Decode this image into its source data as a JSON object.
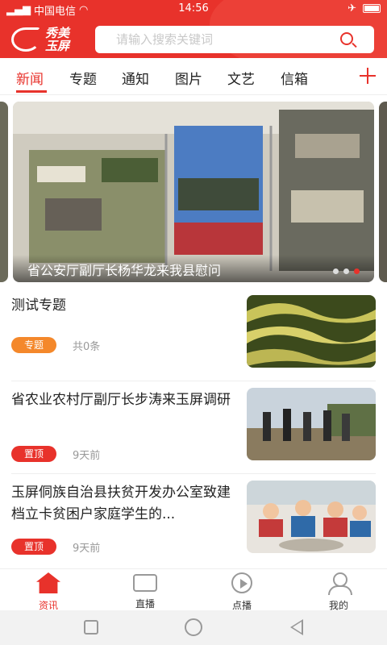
{
  "status_bar": {
    "carrier": "中国电信",
    "time": "14:56"
  },
  "header": {
    "logo_text_line1": "秀美",
    "logo_text_line2": "玉屏",
    "search_placeholder": "请输入搜索关键词"
  },
  "tabs": [
    {
      "label": "新闻",
      "active": true
    },
    {
      "label": "专题",
      "active": false
    },
    {
      "label": "通知",
      "active": false
    },
    {
      "label": "图片",
      "active": false
    },
    {
      "label": "文艺",
      "active": false
    },
    {
      "label": "信箱",
      "active": false
    }
  ],
  "carousel": {
    "caption": "省公安厅副厅长杨华龙来我县慰问",
    "dot_count": 3,
    "active_dot": 3
  },
  "list": [
    {
      "title": "测试专题",
      "badge": "专题",
      "meta": "共0条"
    },
    {
      "title": "省农业农村厅副厅长步涛来玉屏调研",
      "badge": "置顶",
      "meta": "9天前"
    },
    {
      "title": "玉屏侗族自治县扶贫开发办公室致建档立卡贫困户家庭学生的...",
      "badge": "置顶",
      "meta": "9天前"
    }
  ],
  "bottom_nav": [
    {
      "label": "资讯",
      "icon": "home-icon",
      "active": true
    },
    {
      "label": "直播",
      "icon": "video-camera-icon",
      "active": false
    },
    {
      "label": "点播",
      "icon": "play-icon",
      "active": false
    },
    {
      "label": "我的",
      "icon": "user-icon",
      "active": false
    }
  ],
  "colors": {
    "primary": "#e8322b",
    "badge_orange": "#f4882b"
  }
}
